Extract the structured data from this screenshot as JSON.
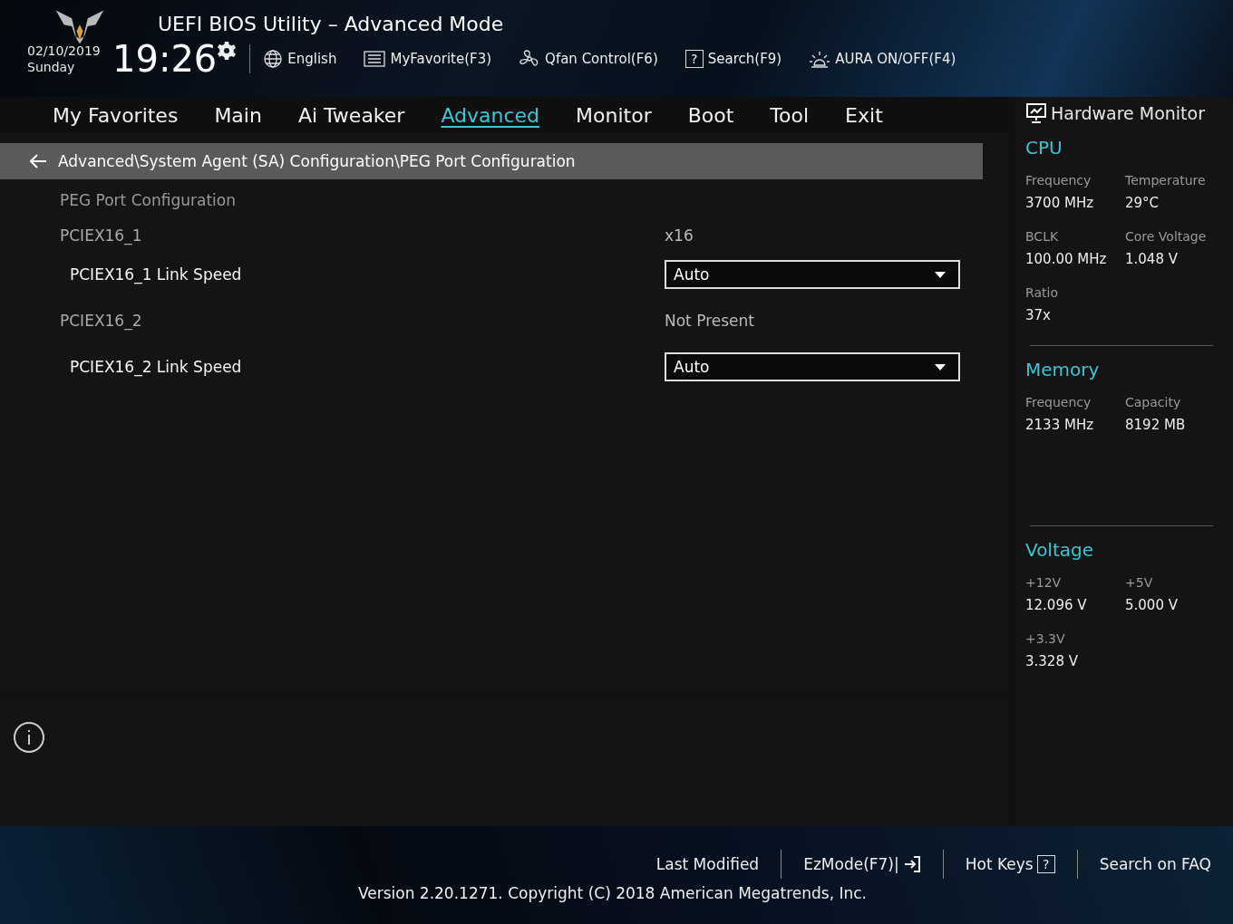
{
  "header": {
    "title": "UEFI BIOS Utility – Advanced Mode",
    "date": "02/10/2019",
    "day": "Sunday",
    "time": "19:26",
    "tools": [
      {
        "kind": "globe",
        "label": "English"
      },
      {
        "kind": "list",
        "label": "MyFavorite(F3)"
      },
      {
        "kind": "fan",
        "label": "Qfan Control(F6)"
      },
      {
        "kind": "help",
        "glyph": "?",
        "label": "Search(F9)"
      },
      {
        "kind": "aura",
        "label": "AURA ON/OFF(F4)"
      }
    ]
  },
  "tabs": [
    {
      "label": "My Favorites",
      "selected": false
    },
    {
      "label": "Main",
      "selected": false
    },
    {
      "label": "Ai Tweaker",
      "selected": false
    },
    {
      "label": "Advanced",
      "selected": true
    },
    {
      "label": "Monitor",
      "selected": false
    },
    {
      "label": "Boot",
      "selected": false
    },
    {
      "label": "Tool",
      "selected": false
    },
    {
      "label": "Exit",
      "selected": false
    }
  ],
  "breadcrumb": "Advanced\\System Agent (SA) Configuration\\PEG Port Configuration",
  "settings": [
    {
      "kind": "heading",
      "label": "PEG Port Configuration"
    },
    {
      "kind": "info",
      "label": "PCIEX16_1",
      "value": "x16"
    },
    {
      "kind": "dropdown",
      "label": "PCIEX16_1 Link Speed",
      "value": "Auto"
    },
    {
      "kind": "info",
      "label": "PCIEX16_2",
      "value": "Not Present"
    },
    {
      "kind": "dropdown",
      "label": "PCIEX16_2 Link Speed",
      "value": "Auto"
    }
  ],
  "hardware_monitor": {
    "title": "Hardware Monitor",
    "sections": [
      {
        "title": "CPU",
        "items": [
          {
            "label": "Frequency",
            "value": "3700 MHz"
          },
          {
            "label": "Temperature",
            "value": "29°C"
          },
          {
            "label": "BCLK",
            "value": "100.00 MHz"
          },
          {
            "label": "Core Voltage",
            "value": "1.048 V"
          },
          {
            "label": "Ratio",
            "value": "37x"
          }
        ]
      },
      {
        "title": "Memory",
        "items": [
          {
            "label": "Frequency",
            "value": "2133 MHz"
          },
          {
            "label": "Capacity",
            "value": "8192 MB"
          }
        ]
      },
      {
        "title": "Voltage",
        "items": [
          {
            "label": "+12V",
            "value": "12.096 V"
          },
          {
            "label": "+5V",
            "value": "5.000 V"
          },
          {
            "label": "+3.3V",
            "value": "3.328 V"
          }
        ]
      }
    ]
  },
  "footer": {
    "links": [
      {
        "kind": "plain",
        "label": "Last Modified"
      },
      {
        "kind": "exit",
        "label": "EzMode(F7)|"
      },
      {
        "kind": "help",
        "label": "Hot Keys",
        "glyph": "?"
      },
      {
        "kind": "plain",
        "label": "Search on FAQ"
      }
    ],
    "version": "Version 2.20.1271. Copyright (C) 2018 American Megatrends, Inc."
  }
}
